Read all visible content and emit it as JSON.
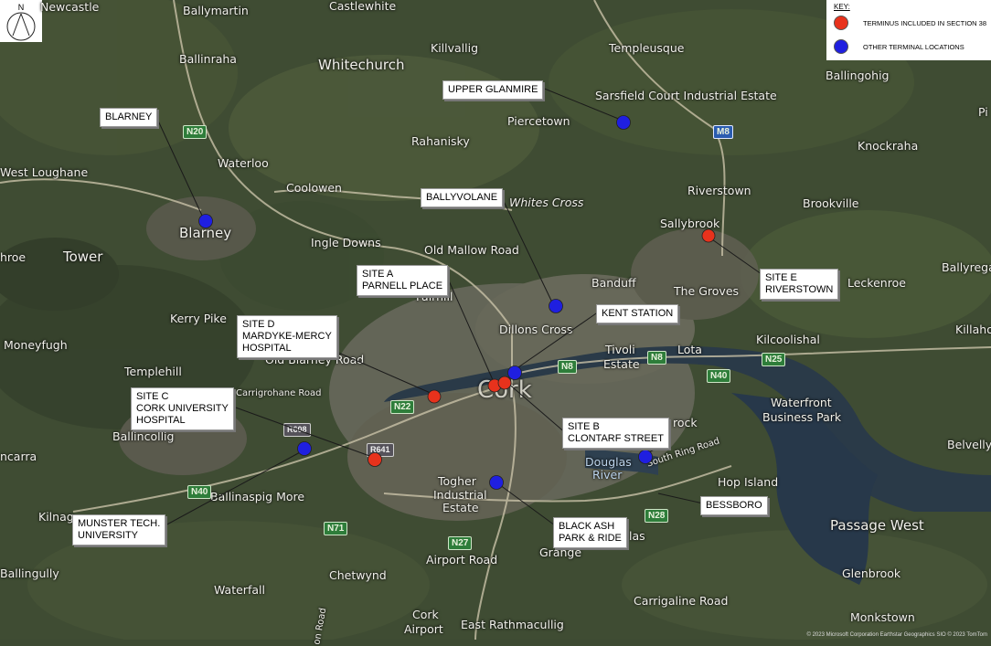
{
  "north": {
    "letter": "N"
  },
  "key": {
    "title": "KEY:",
    "items": [
      {
        "label": "TERMINUS INCLUDED IN SECTION 38",
        "color": "#e8321c"
      },
      {
        "label": "OTHER TERMINAL LOCATIONS",
        "color": "#1f1fe0"
      }
    ]
  },
  "callouts": {
    "blarney": [
      "BLARNEY"
    ],
    "upper_glanmire": [
      "UPPER GLANMIRE"
    ],
    "ballyvolane": [
      "BALLYVOLANE"
    ],
    "site_a": [
      "SITE A",
      "PARNELL PLACE"
    ],
    "site_d": [
      "SITE D",
      "MARDYKE-MERCY",
      "HOSPITAL"
    ],
    "kent_station": [
      "KENT STATION"
    ],
    "site_e": [
      "SITE E",
      "RIVERSTOWN"
    ],
    "site_c": [
      "SITE C",
      "CORK UNIVERSITY",
      "HOSPITAL"
    ],
    "site_b": [
      "SITE B",
      "CLONTARF STREET"
    ],
    "bessboro": [
      "BESSBORO"
    ],
    "black_ash": [
      "BLACK ASH",
      "PARK & RIDE"
    ],
    "munster_tech": [
      "MUNSTER TECH.",
      "UNIVERSITY"
    ]
  },
  "places": {
    "newcastle": "Newcastle",
    "ballymartin": "Ballymartin",
    "castlewhite": "Castlewhite",
    "killvallig": "Killvallig",
    "templeusque": "Templeusque",
    "ballingohig": "Ballingohig",
    "ballinraha": "Ballinraha",
    "whitechurch": "Whitechurch",
    "sarsfield": "Sarsfield Court Industrial Estate",
    "piercetown": "Piercetown",
    "rahanisky": "Rahanisky",
    "knockraha": "Knockraha",
    "west_loughane": "West Loughane",
    "waterloo": "Waterloo",
    "coolowen": "Coolowen",
    "whites_cross": "Whites Cross",
    "riverstown": "Riverstown",
    "brookville": "Brookville",
    "sallybrook": "Sallybrook",
    "blarney": "Blarney",
    "ingle_downs": "Ingle Downs",
    "old_mallow": "Old Mallow Road",
    "tower": "Tower",
    "hroe": "hroe",
    "ballyrega": "Ballyrega",
    "banduff": "Banduff",
    "the_groves": "The Groves",
    "leckenroe": "Leckenroe",
    "fairhill": "Fairhill",
    "kerry_pike": "Kerry Pike",
    "dillons_cross": "Dillons Cross",
    "kilcoolishal": "Kilcoolishal",
    "killahora": "Killahora",
    "moneyfugh": "Moneyfugh",
    "old_blarney": "Old Blarney Road",
    "tivoli": "Tivoli",
    "estate": "Estate",
    "lota": "Lota",
    "templehill": "Templehill",
    "carrigrohane": "Carrigrohane Road",
    "cork": "Cork",
    "waterfront": "Waterfront",
    "business_park": "Business Park",
    "ballincollig": "Ballincollig",
    "rock": "rock",
    "belvelly": "Belvelly",
    "ncarra": "ncarra",
    "douglas": "Douglas",
    "river": "River",
    "south_ring": "South Ring Road",
    "togher": "Togher",
    "industrial": "Industrial",
    "estate2": "Estate",
    "hop_island": "Hop Island",
    "ballinaspig": "Ballinaspig More",
    "kilnag": "Kilnag",
    "passage_west": "Passage West",
    "las": "las",
    "grange": "Grange",
    "airport_road": "Airport Road",
    "ballingully": "Ballingully",
    "chetwynd": "Chetwynd",
    "glenbrook": "Glenbrook",
    "waterfall": "Waterfall",
    "carrigaline_road": "Carrigaline Road",
    "cork_airport1": "Cork",
    "cork_airport2": "Airport",
    "east_rath": "East Rathmacullig",
    "monkstown": "Monkstown",
    "pi": "Pi",
    "on_road": "on Road"
  },
  "roads": {
    "n20": "N20",
    "m8": "M8",
    "n22": "N22",
    "n8a": "N8",
    "n8b": "N8",
    "n25": "N25",
    "n40a": "N40",
    "n40b": "N40",
    "n71": "N71",
    "n27": "N27",
    "n28": "N28",
    "r608": "R608",
    "r641": "R641"
  },
  "attribution": "© 2023 Microsoft Corporation Earthstar Geographics SIO © 2023 TomTom"
}
